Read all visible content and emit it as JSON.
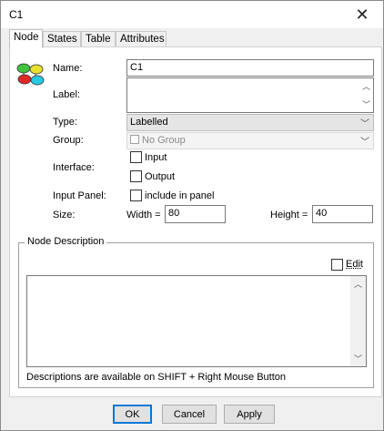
{
  "window": {
    "title": "C1"
  },
  "tabs": [
    {
      "label": "Node",
      "active": true
    },
    {
      "label": "States",
      "active": false
    },
    {
      "label": "Table",
      "active": false
    },
    {
      "label": "Attributes",
      "active": false
    }
  ],
  "form": {
    "name_label": "Name:",
    "name_value": "C1",
    "label_label": "Label:",
    "label_value": "",
    "type_label": "Type:",
    "type_value": "Labelled",
    "group_label": "Group:",
    "group_value": "No Group",
    "interface_label": "Interface:",
    "interface_input": "Input",
    "interface_output": "Output",
    "input_panel_label": "Input Panel:",
    "include_in_panel": "include in panel",
    "size_label": "Size:",
    "width_label": "Width =",
    "width_value": "80",
    "height_label": "Height =",
    "height_value": "40"
  },
  "description": {
    "group_title": "Node Description",
    "edit_label": "Edit",
    "text": "",
    "hint": "Descriptions are available on SHIFT + Right Mouse Button"
  },
  "buttons": {
    "ok": "OK",
    "cancel": "Cancel",
    "apply": "Apply"
  },
  "colors": {
    "accent": "#0078d7",
    "panel": "#ffffff",
    "window": "#f0f0f0"
  }
}
